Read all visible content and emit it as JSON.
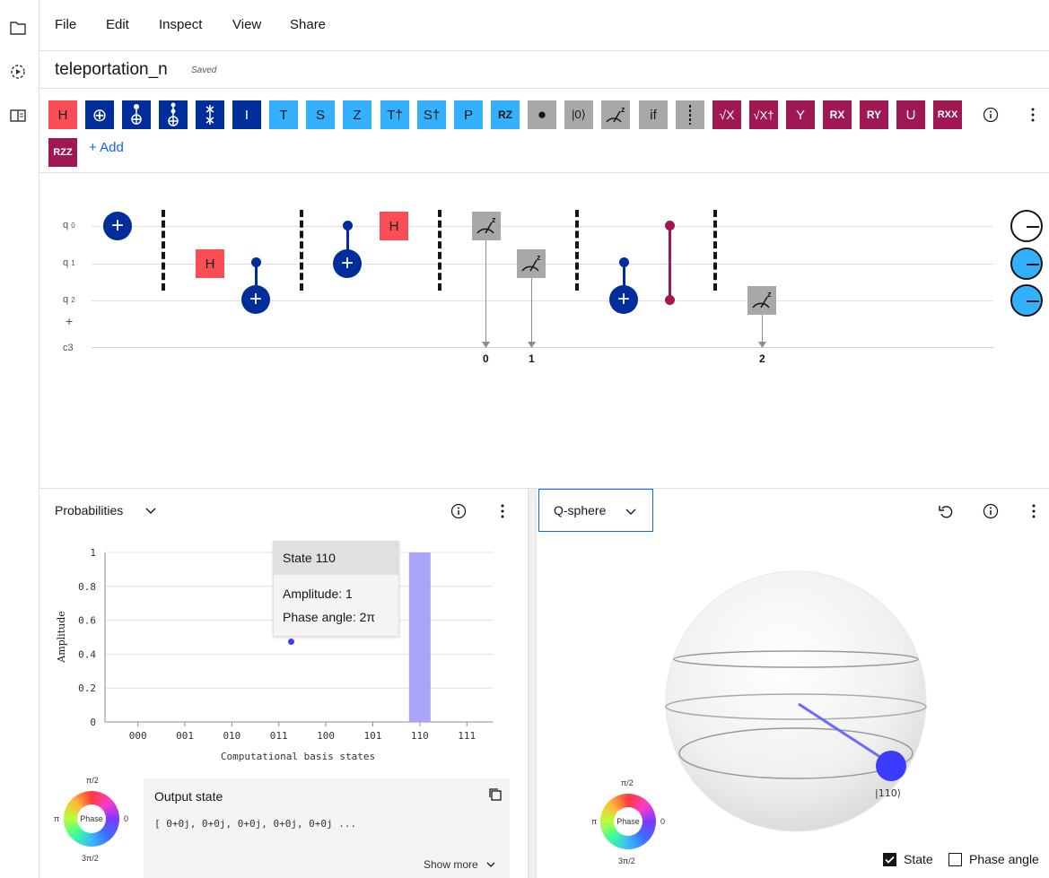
{
  "menu": {
    "file": "File",
    "edit": "Edit",
    "inspect": "Inspect",
    "view": "View",
    "share": "Share"
  },
  "doc": {
    "title": "teleportation_n",
    "status": "Saved"
  },
  "palette": {
    "gates": [
      "H",
      "⊕",
      "",
      "",
      "",
      "I",
      "T",
      "S",
      "Z",
      "T†",
      "S†",
      "P",
      "RZ",
      "●",
      "|0⟩",
      "",
      "if",
      "",
      "√X",
      "√X†",
      "Y",
      "RX",
      "RY",
      "U",
      "RXX",
      "RZZ"
    ],
    "add_label": "+ Add"
  },
  "circuit": {
    "qubits": [
      "q",
      "q",
      "q"
    ],
    "qubit_indices": [
      "0",
      "1",
      "2"
    ],
    "add_qubit": "+",
    "creg": "c3",
    "gate_h": "H",
    "cbits": [
      "0",
      "1",
      "2"
    ]
  },
  "probabilities": {
    "title": "Probabilities",
    "ylabel": "Amplitude",
    "xlabel": "Computational basis states",
    "tooltip": {
      "header": "State 110",
      "amplitude": "Amplitude: 1",
      "phase": "Phase angle: 2π"
    }
  },
  "chart_data": {
    "type": "bar",
    "categories": [
      "000",
      "001",
      "010",
      "011",
      "100",
      "101",
      "110",
      "111"
    ],
    "values": [
      0,
      0,
      0,
      0,
      0,
      0,
      1,
      0
    ],
    "xlabel": "Computational basis states",
    "ylabel": "Amplitude",
    "ylim": [
      0,
      1
    ],
    "yticks": [
      "0",
      "0.2",
      "0.4",
      "0.6",
      "0.8",
      "1"
    ],
    "bar_color": "#a9a4f8"
  },
  "phase_wheel": {
    "top": "π/2",
    "left": "π",
    "right": "0",
    "bottom": "3π/2",
    "center": "Phase"
  },
  "output_state": {
    "title": "Output state",
    "value": "[ 0+0j, 0+0j, 0+0j, 0+0j, 0+0j ...",
    "show_more": "Show more"
  },
  "qsphere": {
    "title": "Q-sphere",
    "state_label": "|110⟩",
    "state_checkbox": "State",
    "phase_checkbox": "Phase angle"
  },
  "colors": {
    "accent": "#0f62fe",
    "navy": "#002d9c",
    "light_blue": "#33b1ff",
    "red": "#fa4d56",
    "magenta": "#9f1853",
    "gray": "#a8a8a8"
  }
}
